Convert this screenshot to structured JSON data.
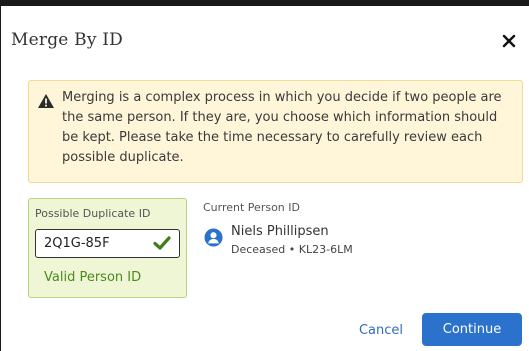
{
  "dialog": {
    "title": "Merge By ID",
    "close_icon": "close-icon"
  },
  "warning": {
    "icon": "warning-triangle-icon",
    "text": "Merging is a complex process in which you decide if two people are the same person. If they are, you choose which information should be kept. Please take the time necessary to carefully review each possible duplicate.",
    "background_color": "#fff5d9",
    "border_color": "#f1da93"
  },
  "possible_duplicate": {
    "label": "Possible Duplicate ID",
    "value": "2Q1G-85F",
    "status_icon": "checkmark-icon",
    "valid_text": "Valid Person ID",
    "valid_color": "#4c8a1e",
    "panel_color": "#eef6d6"
  },
  "current_person": {
    "label": "Current Person ID",
    "icon": "person-icon",
    "name": "Niels Phillipsen",
    "meta": "Deceased • KL23-6LM"
  },
  "actions": {
    "cancel_label": "Cancel",
    "continue_label": "Continue",
    "accent_color": "#2b72cc"
  }
}
